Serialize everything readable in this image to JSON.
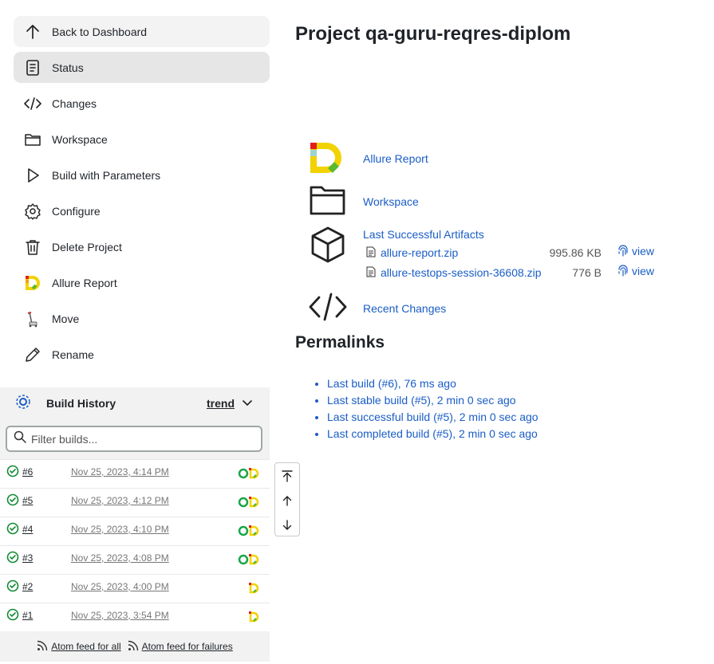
{
  "sidebar": {
    "tasks": [
      {
        "label": "Back to Dashboard",
        "icon": "arrow-up-icon"
      },
      {
        "label": "Status",
        "icon": "document-icon"
      },
      {
        "label": "Changes",
        "icon": "code-icon"
      },
      {
        "label": "Workspace",
        "icon": "folder-icon"
      },
      {
        "label": "Build with Parameters",
        "icon": "play-icon"
      },
      {
        "label": "Configure",
        "icon": "gear-icon"
      },
      {
        "label": "Delete Project",
        "icon": "trash-icon"
      },
      {
        "label": "Allure Report",
        "icon": "allure-icon"
      },
      {
        "label": "Move",
        "icon": "move-icon"
      },
      {
        "label": "Rename",
        "icon": "pencil-icon"
      }
    ]
  },
  "build_history": {
    "title": "Build History",
    "trend_label": "trend",
    "filter_placeholder": "Filter builds...",
    "builds": [
      {
        "number": "#6",
        "date": "Nov 25, 2023, 4:14 PM",
        "status": "success"
      },
      {
        "number": "#5",
        "date": "Nov 25, 2023, 4:12 PM",
        "status": "success"
      },
      {
        "number": "#4",
        "date": "Nov 25, 2023, 4:10 PM",
        "status": "success"
      },
      {
        "number": "#3",
        "date": "Nov 25, 2023, 4:08 PM",
        "status": "success"
      },
      {
        "number": "#2",
        "date": "Nov 25, 2023, 4:00 PM",
        "status": "success"
      },
      {
        "number": "#1",
        "date": "Nov 25, 2023, 3:54 PM",
        "status": "success"
      }
    ],
    "feed_all": "Atom feed for all",
    "feed_failures": "Atom feed for failures"
  },
  "main": {
    "title": "Project qa-guru-reqres-diplom",
    "links": {
      "allure": "Allure Report",
      "workspace": "Workspace",
      "artifacts": "Last Successful Artifacts",
      "changes": "Recent Changes"
    },
    "artifacts": [
      {
        "name": "allure-report.zip",
        "size": "995.86 KB",
        "view": "view"
      },
      {
        "name": "allure-testops-session-36608.zip",
        "size": "776 B",
        "view": "view"
      }
    ],
    "permalinks_title": "Permalinks",
    "permalinks": [
      "Last build (#6), 76 ms ago",
      "Last stable build (#5), 2 min 0 sec ago",
      "Last successful build (#5), 2 min 0 sec ago",
      "Last completed build (#5), 2 min 0 sec ago"
    ]
  },
  "colors": {
    "link": "#1a5dc6",
    "success": "#138a36",
    "allure_yellow": "#f2d200",
    "allure_red": "#e0201b",
    "allure_green": "#5cb82e"
  }
}
